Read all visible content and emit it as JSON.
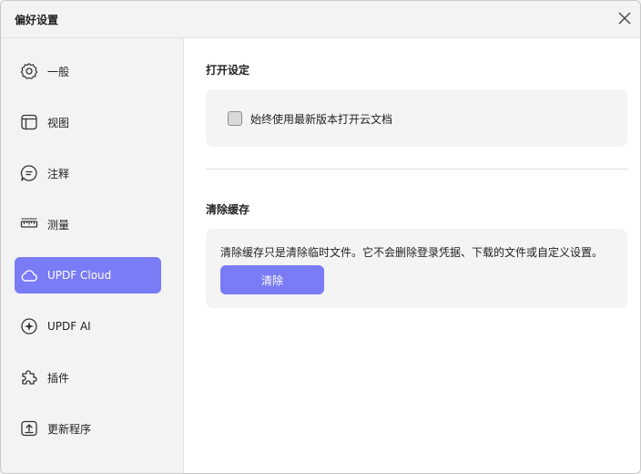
{
  "window": {
    "title": "偏好设置"
  },
  "sidebar": {
    "items": [
      {
        "label": "一般",
        "icon": "gear-icon"
      },
      {
        "label": "视图",
        "icon": "layout-icon"
      },
      {
        "label": "注释",
        "icon": "comment-icon"
      },
      {
        "label": "测量",
        "icon": "ruler-icon"
      },
      {
        "label": "UPDF Cloud",
        "icon": "cloud-icon",
        "active": true
      },
      {
        "label": "UPDF AI",
        "icon": "ai-icon"
      },
      {
        "label": "插件",
        "icon": "puzzle-icon"
      },
      {
        "label": "更新程序",
        "icon": "update-icon"
      }
    ]
  },
  "open_settings": {
    "title": "打开设定",
    "checkbox_label": "始终使用最新版本打开云文档",
    "checked": false
  },
  "clear_cache": {
    "title": "清除缓存",
    "description": "清除缓存只是清除临时文件。它不会删除登录凭据、下载的文件或自定义设置。",
    "button_label": "清除"
  },
  "colors": {
    "accent": "#7a7cf5",
    "card": "#f4f4f4"
  }
}
